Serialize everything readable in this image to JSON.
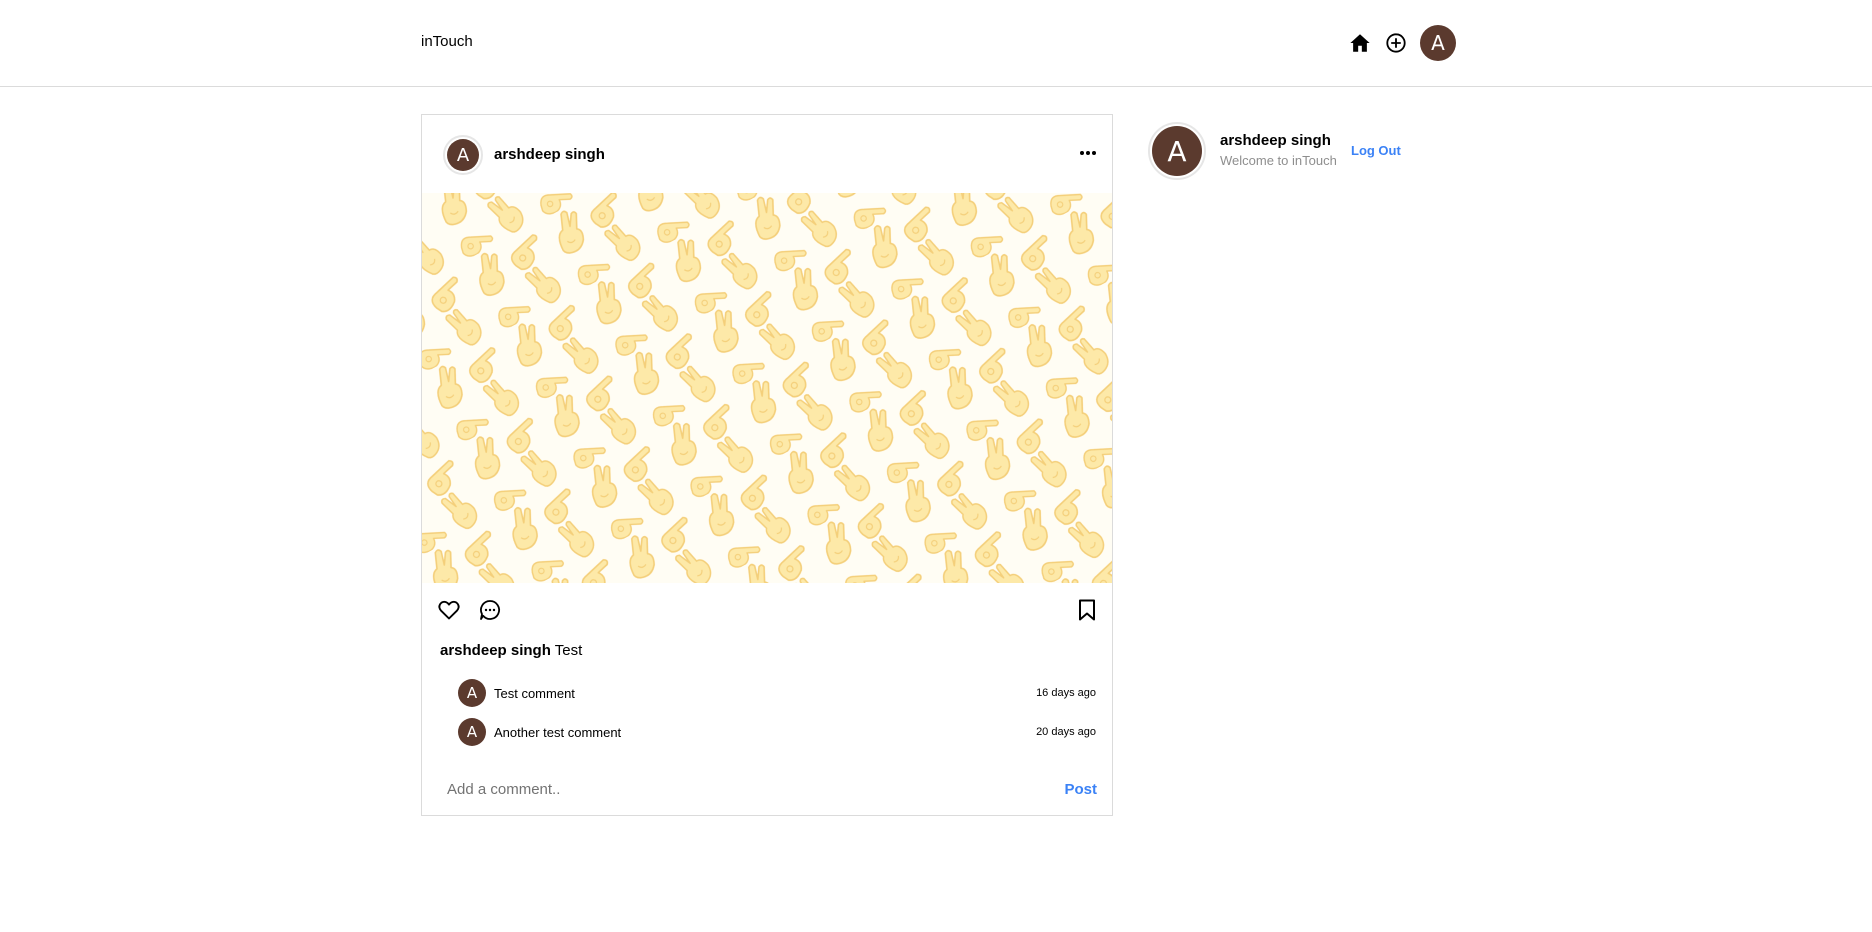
{
  "header": {
    "brand": "inTouch",
    "user_initial": "A"
  },
  "post": {
    "username": "arshdeep singh",
    "user_initial": "A",
    "caption_user": "arshdeep singh",
    "caption_text": "Test",
    "comments": [
      {
        "initial": "A",
        "text": "Test comment",
        "time": "16 days ago"
      },
      {
        "initial": "A",
        "text": "Another test comment",
        "time": "20 days ago"
      }
    ],
    "add_comment_placeholder": "Add a comment..",
    "post_label": "Post"
  },
  "sidebar": {
    "user_initial": "A",
    "name": "arshdeep singh",
    "subtitle": "Welcome to inTouch",
    "logout_label": "Log Out"
  },
  "colors": {
    "avatar": "#5b3a2e",
    "accent": "#3b82f6",
    "border": "#dbdbdb",
    "pattern_fill": "#fde9a8",
    "pattern_stroke": "#f4cf7a"
  }
}
